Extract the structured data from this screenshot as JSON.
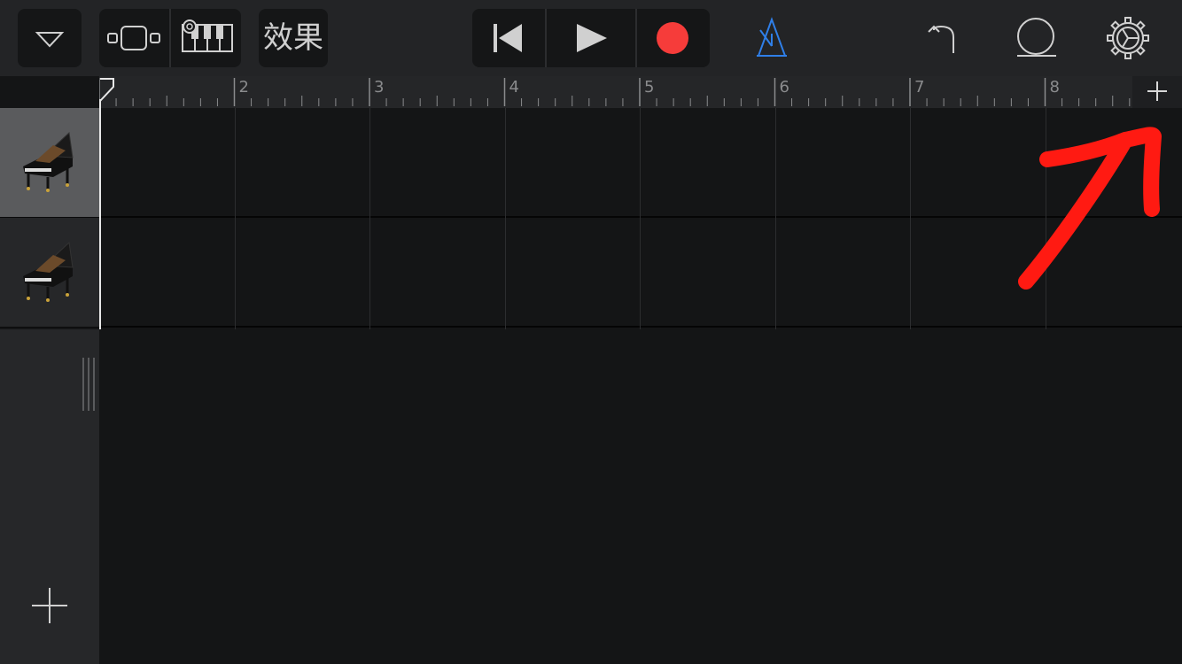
{
  "toolbar": {
    "fx_label": "效果",
    "icons": [
      "dropdown-triangle-icon",
      "track-view-icon",
      "keyboard-settings-icon",
      "rewind-icon",
      "play-icon",
      "record-icon",
      "metronome-icon",
      "undo-icon",
      "loop-icon",
      "settings-gear-icon"
    ],
    "record_color": "#f63c3a",
    "metronome_color": "#2f7fe8"
  },
  "ruler": {
    "bars": [
      "2",
      "3",
      "4",
      "5",
      "6",
      "7",
      "8"
    ],
    "add_label": "+"
  },
  "tracks": [
    {
      "instrument_icon": "grand-piano-icon",
      "selected": true
    },
    {
      "instrument_icon": "grand-piano-icon",
      "selected": false
    }
  ],
  "annotation": {
    "color": "#ff1a12",
    "shape": "red-arrow-pointing-top-right"
  }
}
